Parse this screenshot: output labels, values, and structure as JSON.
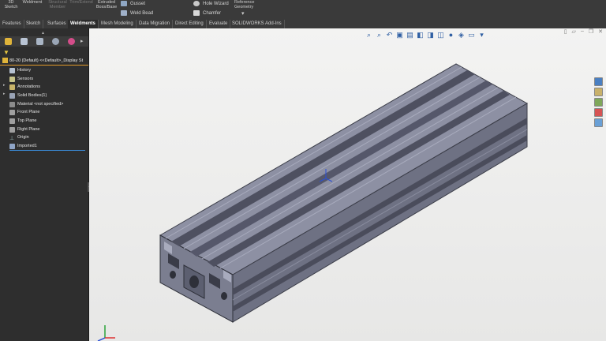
{
  "ribbon": {
    "sketch3d": "3D\nSketch",
    "weldment": "Weldment",
    "structural_member": "Structural\nMember",
    "trim_extend": "Trim/Extend",
    "extruded_boss": "Extruded\nBoss/Base",
    "gusset": "Gusset",
    "weld_bead": "Weld Bead",
    "hole_wizard": "Hole Wizard",
    "chamfer": "Chamfer",
    "ref_geometry": "Reference\nGeometry"
  },
  "tabs": [
    "Features",
    "Sketch",
    "Surfaces",
    "Weldments",
    "Mesh Modeling",
    "Data Migration",
    "Direct Editing",
    "Evaluate",
    "SOLIDWORKS Add-Ins"
  ],
  "active_tab": "Weldments",
  "tree": {
    "root": "80-20 (Default) <<Default>_Display St",
    "items": [
      "History",
      "Sensors",
      "Annotations",
      "Solid Bodies(1)",
      "Material <not specified>",
      "Front Plane",
      "Top Plane",
      "Right Plane",
      "Origin",
      "Imported1"
    ]
  },
  "colors": {
    "accent": "#e19a2a",
    "select": "#3a8ad6",
    "beam": "#8c8fa2"
  }
}
